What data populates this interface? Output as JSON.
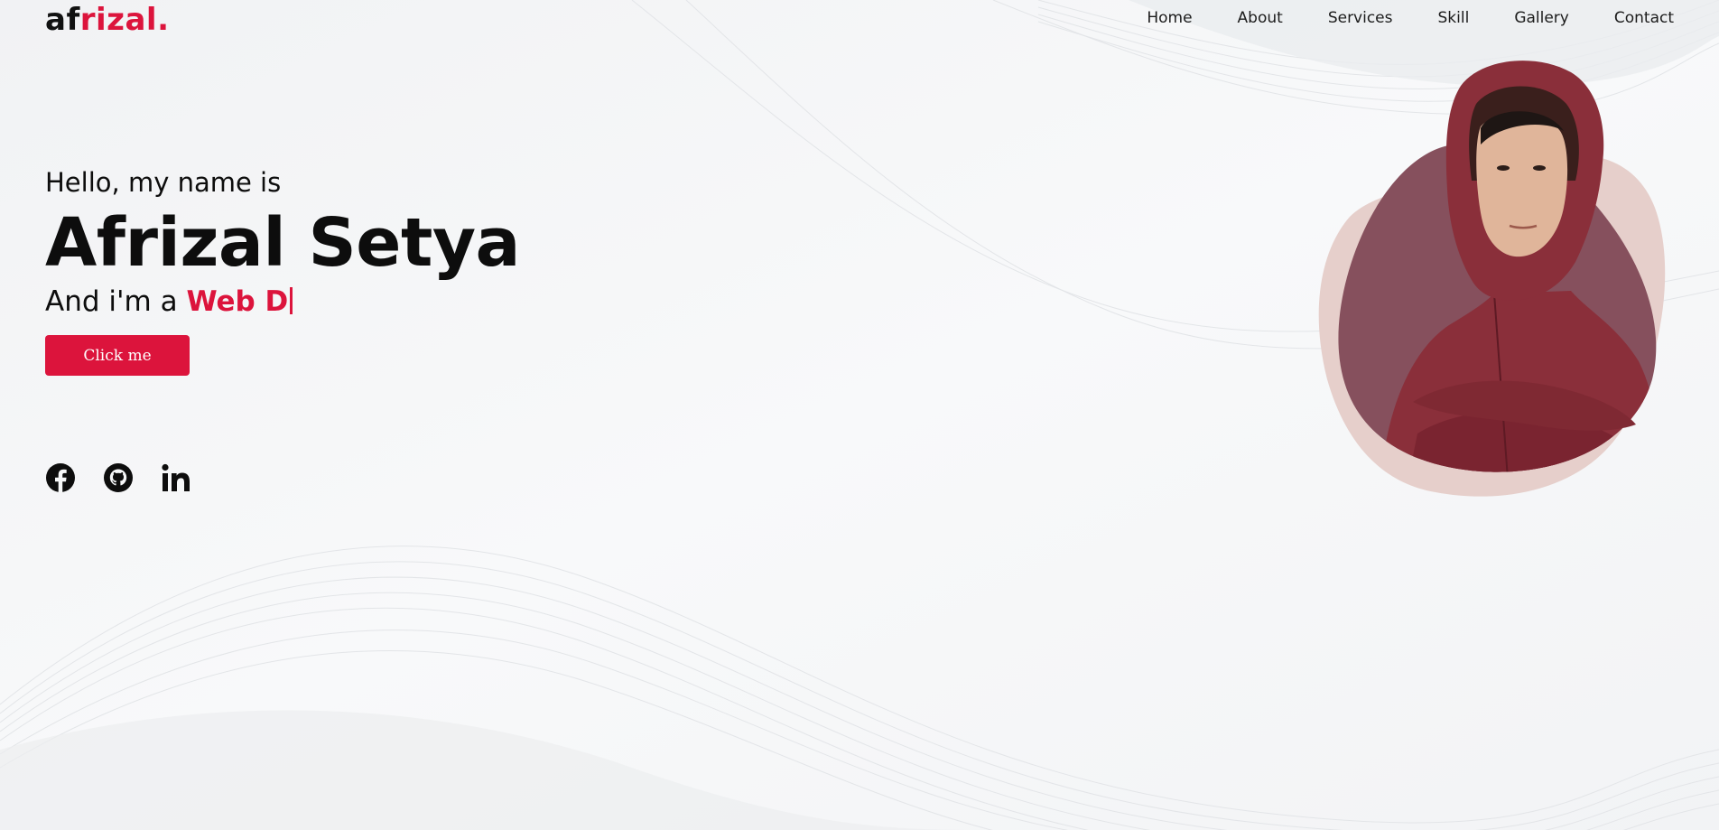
{
  "logo": {
    "part1": "af",
    "part2": "rizal",
    "dot": "."
  },
  "nav": {
    "items": [
      {
        "label": "Home"
      },
      {
        "label": "About"
      },
      {
        "label": "Services"
      },
      {
        "label": "Skill"
      },
      {
        "label": "Gallery"
      },
      {
        "label": "Contact"
      }
    ]
  },
  "hero": {
    "greeting": "Hello, my name is",
    "name": "Afrizal Setya",
    "role_prefix": "And i'm a ",
    "role_typed": "Web D",
    "cta_label": "Click me"
  },
  "socials": {
    "icons": [
      "facebook-icon",
      "github-icon",
      "linkedin-icon"
    ]
  },
  "colors": {
    "accent": "#dc143c",
    "text": "#0d0d0d",
    "background": "#f6f7f8",
    "blob_back": "#e6cfcb",
    "blob_front": "#86505d",
    "hoodie": "#8a2f3a"
  }
}
